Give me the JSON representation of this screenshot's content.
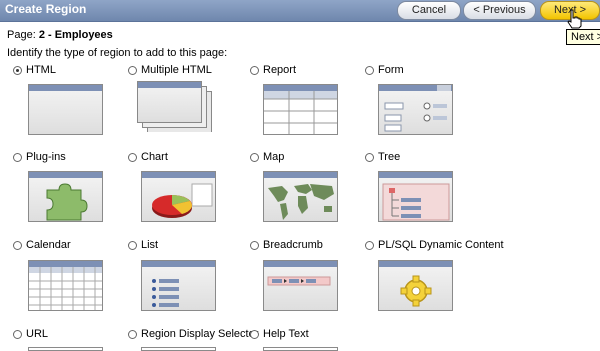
{
  "header": {
    "title": "Create Region",
    "cancel_label": "Cancel",
    "previous_label": "< Previous",
    "next_label": "Next >",
    "tooltip": "Next >"
  },
  "page": {
    "label_prefix": "Page:",
    "label_value": "2 - Employees",
    "instruction": "Identify the type of region to add to this page:"
  },
  "region_types": [
    {
      "label": "HTML",
      "selected": true
    },
    {
      "label": "Multiple HTML",
      "selected": false
    },
    {
      "label": "Report",
      "selected": false
    },
    {
      "label": "Form",
      "selected": false
    },
    {
      "label": "Plug-ins",
      "selected": false
    },
    {
      "label": "Chart",
      "selected": false
    },
    {
      "label": "Map",
      "selected": false
    },
    {
      "label": "Tree",
      "selected": false
    },
    {
      "label": "Calendar",
      "selected": false
    },
    {
      "label": "List",
      "selected": false
    },
    {
      "label": "Breadcrumb",
      "selected": false
    },
    {
      "label": "PL/SQL Dynamic Content",
      "selected": false
    },
    {
      "label": "URL",
      "selected": false
    },
    {
      "label": "Region Display Selector",
      "selected": false
    },
    {
      "label": "Help Text",
      "selected": false
    }
  ],
  "colors": {
    "titlebar": "#7a90b4",
    "next_button": "#f7d23a"
  }
}
